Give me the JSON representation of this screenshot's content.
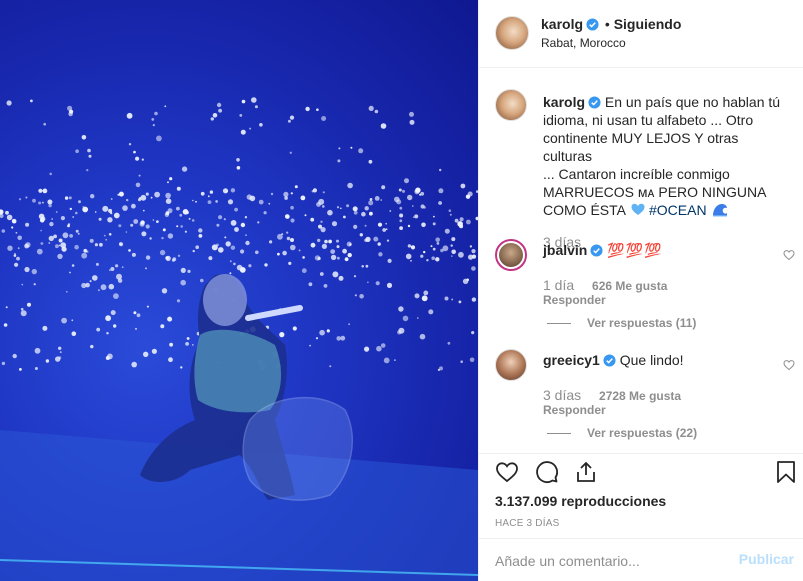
{
  "post": {
    "author": "karolg",
    "follow_separator": "•",
    "follow_status": "Siguiendo",
    "location": "Rabat, Morocco",
    "caption_lines": [
      "En un país que no hablan tú",
      "idioma, ni usan tu alfabeto ... Otro",
      "continente MUY LEJOS Y otras culturas",
      "... Cantaron increíble conmigo",
      "MARRUECOS ᴍᴀ PERO NINGUNA",
      "COMO ÉSTA"
    ],
    "caption_hashtag": "#OCEAN",
    "caption_time": "3 días"
  },
  "comments": [
    {
      "username": "jbalvin",
      "text": "💯💯💯",
      "time": "1 día",
      "likes": "626 Me gusta",
      "reply_label": "Responder",
      "view_replies": "Ver respuestas (11)"
    },
    {
      "username": "greeicy1",
      "text": "Que lindo!",
      "time": "3 días",
      "likes": "2728 Me gusta",
      "reply_label": "Responder",
      "view_replies": "Ver respuestas (22)"
    }
  ],
  "stats": {
    "views": "3.137.099",
    "views_label": "reproducciones",
    "posted": "HACE 3 DÍAS"
  },
  "composer": {
    "placeholder": "Añade un comentario...",
    "publish": "Publicar"
  },
  "icons": {
    "verified": "verified-badge-icon",
    "like": "heart-icon",
    "comment": "comment-bubble-icon",
    "share": "share-icon",
    "save": "bookmark-icon",
    "blue_heart": "blue-heart-emoji",
    "wave": "wave-emoji"
  },
  "colors": {
    "verified": "#3897f0",
    "link": "#003569",
    "muted": "#8e8e8e",
    "publish_disabled": "#b9dffc"
  }
}
